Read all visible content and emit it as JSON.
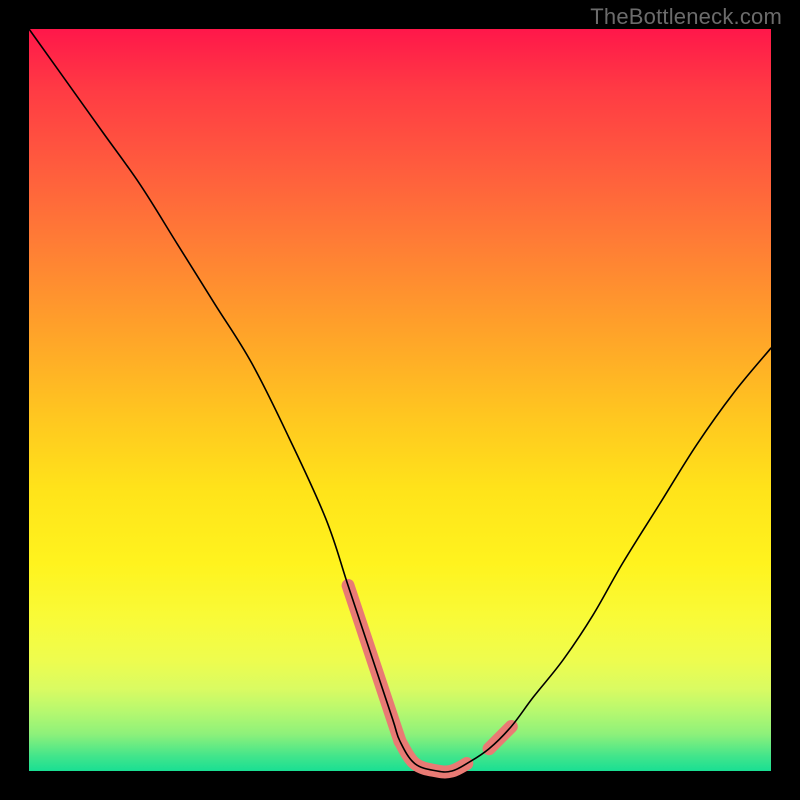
{
  "watermark": "TheBottleneck.com",
  "colors": {
    "background": "#000000",
    "highlight": "#e97a74",
    "curve": "#000000"
  },
  "chart_data": {
    "type": "line",
    "title": "",
    "xlabel": "",
    "ylabel": "",
    "xlim": [
      0,
      100
    ],
    "ylim": [
      0,
      100
    ],
    "grid": false,
    "series": [
      {
        "name": "bottleneck-curve",
        "x": [
          0,
          5,
          10,
          15,
          20,
          25,
          30,
          35,
          40,
          43,
          46,
          49,
          50,
          52,
          55,
          57,
          59,
          62,
          65,
          68,
          72,
          76,
          80,
          85,
          90,
          95,
          100
        ],
        "y": [
          100,
          93,
          86,
          79,
          71,
          63,
          55,
          45,
          34,
          25,
          16,
          7,
          4,
          1,
          0,
          0,
          1,
          3,
          6,
          10,
          15,
          21,
          28,
          36,
          44,
          51,
          57
        ]
      }
    ],
    "highlights": [
      {
        "name": "highlight-left",
        "x_range": [
          42,
          50
        ],
        "note": "descending near-bottom segment"
      },
      {
        "name": "highlight-bottom",
        "x_range": [
          50,
          60
        ],
        "note": "valley floor segment"
      },
      {
        "name": "highlight-right",
        "x_range": [
          60,
          67
        ],
        "note": "ascending near-bottom segment"
      }
    ]
  }
}
